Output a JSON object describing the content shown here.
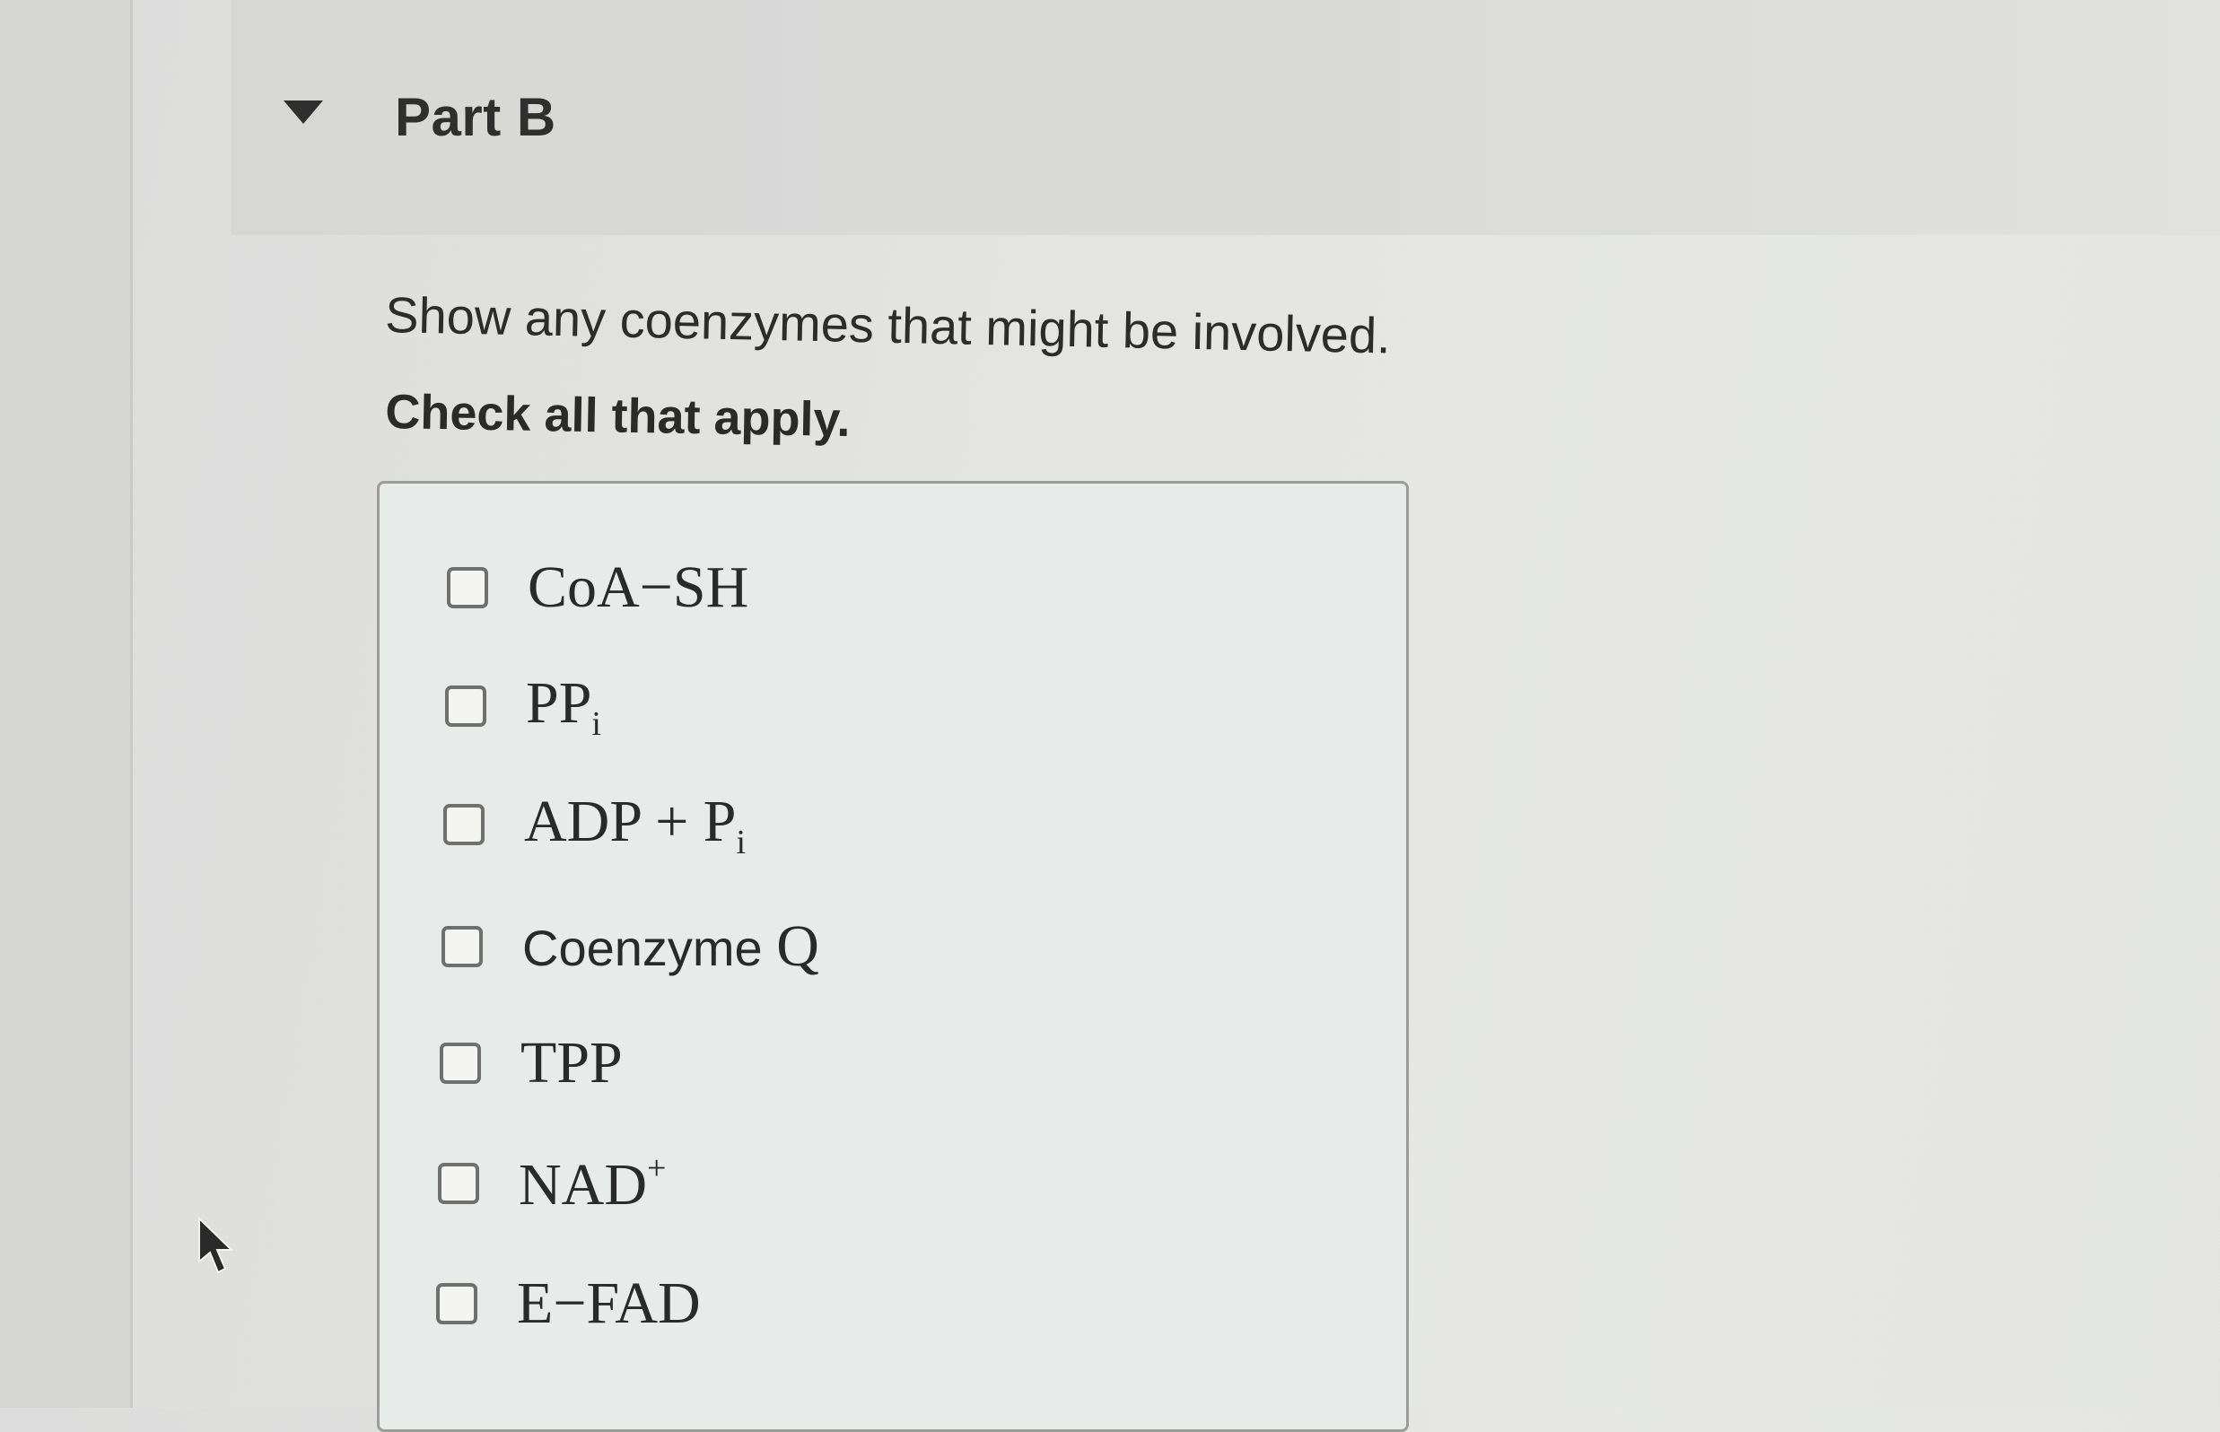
{
  "part": {
    "title": "Part B"
  },
  "question": {
    "prompt": "Show any coenzymes that might be involved.",
    "instruction": "Check all that apply."
  },
  "options": [
    {
      "text": "CoA−SH",
      "checked": false
    },
    {
      "text": "PP",
      "sub": "i",
      "checked": false
    },
    {
      "text": "ADP + P",
      "sub": "i",
      "checked": false
    },
    {
      "text": "Coenzyme ",
      "extra": "Q",
      "checked": false
    },
    {
      "text": "TPP",
      "checked": false
    },
    {
      "text": "NAD",
      "sup": "+",
      "checked": false
    },
    {
      "text": "E−FAD",
      "checked": false
    }
  ],
  "icons": {
    "collapse": "caret-down-icon",
    "cursor": "mouse-pointer-icon"
  },
  "colors": {
    "background": "#e4e5e3",
    "header": "#d9d9d8",
    "border": "#9c9c9b",
    "text": "#2b2b2b"
  }
}
